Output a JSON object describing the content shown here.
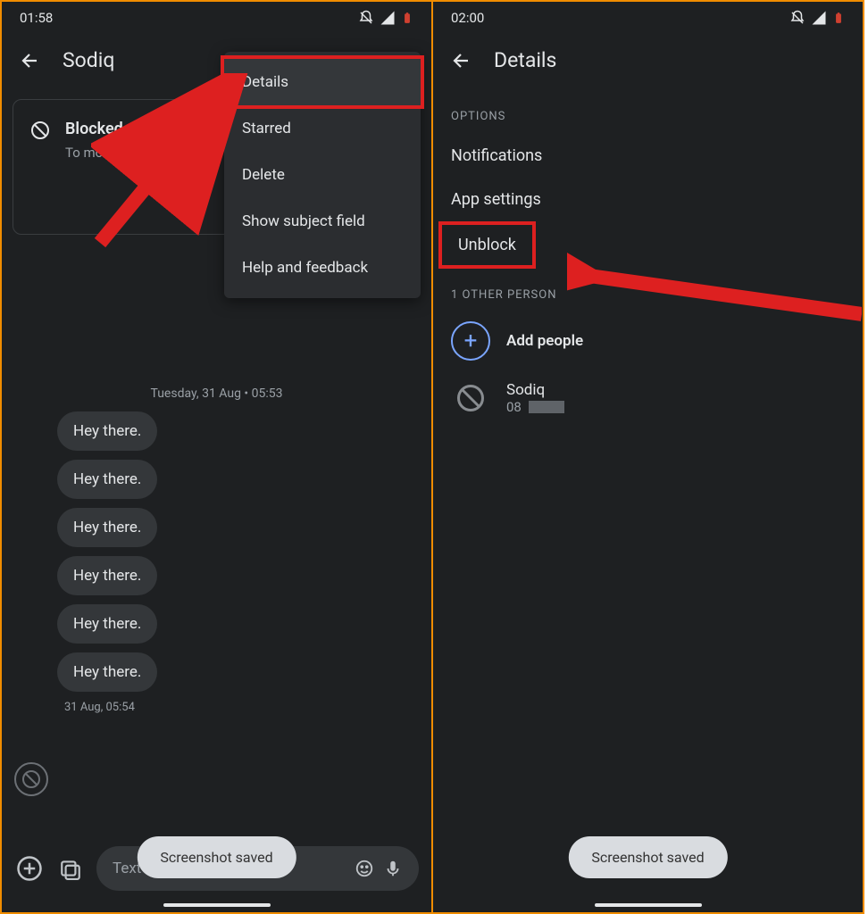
{
  "left": {
    "status_time": "01:58",
    "header_title": "Sodiq",
    "blocked": {
      "title": "Blocked",
      "desc": "To move this conversation blocked' and get messag"
    },
    "menu": {
      "details": "Details",
      "starred": "Starred",
      "delete": "Delete",
      "show_subject": "Show subject field",
      "help": "Help and feedback"
    },
    "date_divider": "Tuesday, 31 Aug • 05:53",
    "messages": [
      "Hey there.",
      "Hey there.",
      "Hey there.",
      "Hey there.",
      "Hey there.",
      "Hey there."
    ],
    "msg_time": "31 Aug, 05:54",
    "input_placeholder": "Text message",
    "toast": "Screenshot saved"
  },
  "right": {
    "status_time": "02:00",
    "header_title": "Details",
    "options_header": "OPTIONS",
    "options": {
      "notifications": "Notifications",
      "app_settings": "App settings",
      "unblock": "Unblock"
    },
    "people_header": "1 OTHER PERSON",
    "add_people": "Add people",
    "contact": {
      "name": "Sodiq",
      "num_prefix": "08"
    },
    "toast": "Screenshot saved"
  }
}
